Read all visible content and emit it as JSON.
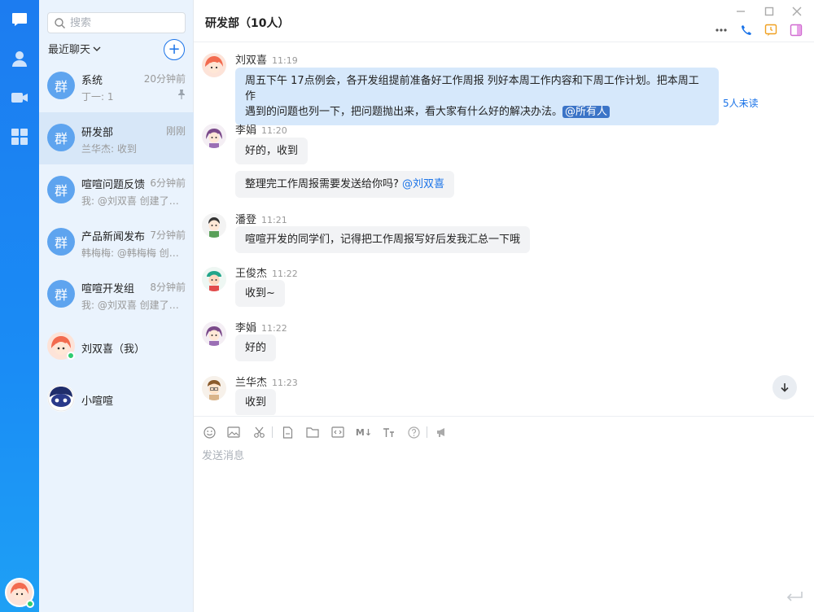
{
  "search": {
    "placeholder": "搜索"
  },
  "session_header": {
    "recent_label": "最近聊天",
    "add_symbol": "+"
  },
  "sessions": [
    {
      "avatar_text": "群",
      "name": "系统",
      "time": "20分钟前",
      "preview": "丁一: 1",
      "pinned": true
    },
    {
      "avatar_text": "群",
      "name": "研发部",
      "time": "刚刚",
      "preview": "兰华杰: 收到",
      "active": true
    },
    {
      "avatar_text": "群",
      "name": "喧喧问题反馈",
      "time": "6分钟前",
      "preview": "我: @刘双喜 创建了讨论组"
    },
    {
      "avatar_text": "群",
      "name": "产品新闻发布",
      "time": "7分钟前",
      "preview": "韩梅梅: @韩梅梅 创建了讨论组"
    },
    {
      "avatar_text": "群",
      "name": "喧喧开发组",
      "time": "8分钟前",
      "preview": "我: @刘双喜 创建了讨论组"
    },
    {
      "name": "刘双喜（我）"
    },
    {
      "name": "小喧喧"
    }
  ],
  "chat": {
    "title": "研发部（10人）",
    "unread_label": "5人未读",
    "messages": [
      {
        "sender": "刘双喜",
        "time": "11:19",
        "text_line1": "周五下午 17点例会，各开发组提前准备好工作周报 列好本周工作内容和下周工作计划。把本周工作",
        "text_line2": "遇到的问题也列一下，把问题抛出来，看大家有什么好的解决办法。",
        "mention": "@所有人"
      },
      {
        "sender": "李娟",
        "time": "11:20",
        "text": "好的，收到"
      },
      {
        "text": "整理完工作周报需要发送给你吗?",
        "mention": "@刘双喜"
      },
      {
        "sender": "潘登",
        "time": "11:21",
        "text": "喧喧开发的同学们，记得把工作周报写好后发我汇总一下哦"
      },
      {
        "sender": "王俊杰",
        "time": "11:22",
        "text": "收到~"
      },
      {
        "sender": "李娟",
        "time": "11:22",
        "text": "好的"
      },
      {
        "sender": "兰华杰",
        "time": "11:23",
        "text": "收到"
      }
    ]
  },
  "composer": {
    "placeholder": "发送消息",
    "markdown_label": "M↓"
  },
  "colors": {
    "rail_blue": "#1c7cf0",
    "accent": "#1a73e8",
    "group_avatar": "#5ea4ef",
    "online": "#2ecc71"
  }
}
